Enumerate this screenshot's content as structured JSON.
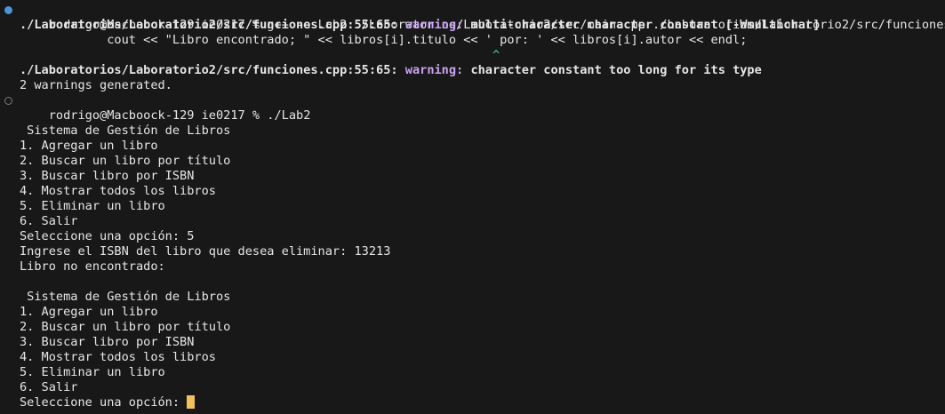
{
  "terminal": {
    "cmd1": {
      "prompt": "rodrigo@Macboock-129 ie0217 % ",
      "command": "g++ -o Lab2 ./Laboratorios/Laboratorio2/src/main.cpp ./Laboratorios/Laboratorio2/src/funciones.cpp"
    },
    "warning1": {
      "location": "./Laboratorios/Laboratorio2/src/funciones.cpp:55:65: ",
      "label": "warning: ",
      "message": "multi-character character constant [-Wmultichar]"
    },
    "source_line": "            cout << \"Libro encontrado; \" << libros[i].titulo << ' por: ' << libros[i].autor << endl;",
    "caret_line": "                                                                 ^",
    "warning2": {
      "location": "./Laboratorios/Laboratorio2/src/funciones.cpp:55:65: ",
      "label": "warning: ",
      "message": "character constant too long for its type"
    },
    "warnings_generated": "2 warnings generated.",
    "cmd2": {
      "prompt": "rodrigo@Macboock-129 ie0217 % ",
      "command": "./Lab2"
    },
    "menu_title": " Sistema de Gestión de Libros",
    "menu_items": [
      "1. Agregar un libro",
      "2. Buscar un libro por título",
      "3. Buscar libro por ISBN",
      "4. Mostrar todos los libros",
      "5. Eliminar un libro",
      "6. Salir"
    ],
    "prompt_option_answered": "Seleccione una opción: 5",
    "isbn_prompt": "Ingrese el ISBN del libro que desea eliminar: 13213",
    "not_found": "Libro no encontrado:",
    "prompt_option_current": "Seleccione una opción: "
  },
  "colors": {
    "background": "#181818",
    "text": "#e6e6e6",
    "warning": "#c9a3f0",
    "caret": "#49d4a6",
    "cursor": "#f2c15b",
    "dot_success": "#4a94d8"
  }
}
